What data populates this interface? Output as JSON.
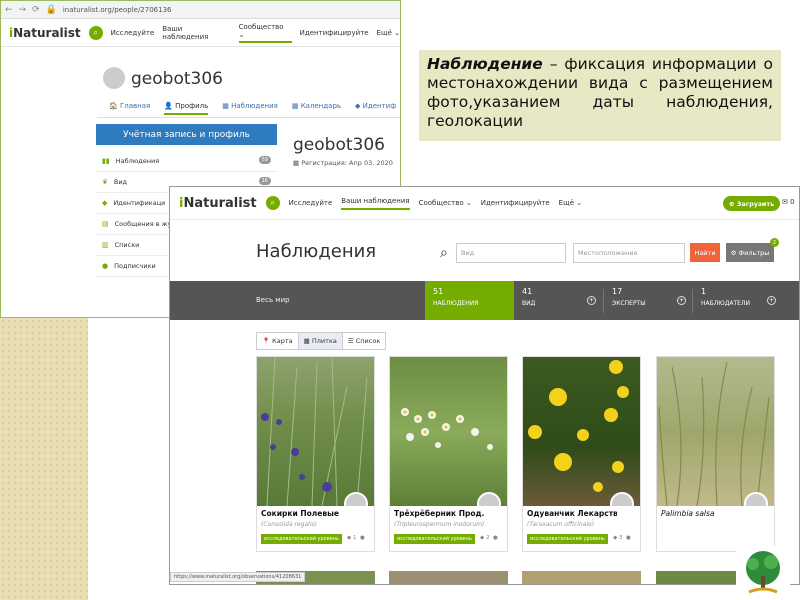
{
  "browser": {
    "url": "inaturalist.org/people/2706136"
  },
  "nav": {
    "logo_i": "i",
    "logo_rest": "Naturalist",
    "explore": "Исследуйте",
    "my_obs": "Ваши наблюдения",
    "community": "Сообщество",
    "identify": "Идентифицируйте",
    "more": "Ещё"
  },
  "profile": {
    "username": "geobot306",
    "tabs": [
      "Главная",
      "Профиль",
      "Наблюдения",
      "Календарь",
      "Идентиф"
    ],
    "account_button": "Учётная запись и профиль",
    "menu": [
      {
        "label": "Наблюдения",
        "badge": "59"
      },
      {
        "label": "Вид",
        "badge": "16"
      },
      {
        "label": "Идентификаци",
        "badge": ""
      },
      {
        "label": "Сообщения в жу",
        "badge": ""
      },
      {
        "label": "Списки",
        "badge": ""
      },
      {
        "label": "Подписчики",
        "badge": ""
      }
    ],
    "registration": "Регистрация: Апр 03, 2020"
  },
  "caption": {
    "term": "Наблюдение",
    "text": " – фиксация информации о местонахождении вида с размещением фото,указанием даты наблюдения, геолокации"
  },
  "obs": {
    "upload": "Загрузить",
    "mail_count": "0",
    "title": "Наблюдения",
    "species_ph": "Вид",
    "location_ph": "Местоположение",
    "find": "Найти",
    "filters": "Фильтры",
    "filter_count": "2",
    "world": "Весь мир",
    "stats": [
      {
        "num": "51",
        "label": "НАБЛЮДЕНИЯ"
      },
      {
        "num": "41",
        "label": "ВИД"
      },
      {
        "num": "17",
        "label": "ЭКСПЕРТЫ"
      },
      {
        "num": "1",
        "label": "НАБЛЮДАТЕЛИ"
      }
    ],
    "views": [
      "Карта",
      "Плитка",
      "Список"
    ],
    "cards": [
      {
        "name": "Сокирки Полевые",
        "latin": "(Consolida regalis)",
        "grade": "исследовательский уровень",
        "count": "1"
      },
      {
        "name": "Трёхрёберник Прод...",
        "latin": "(Tripleurospermum inodorum)",
        "grade": "исследовательский уровень",
        "count": "2"
      },
      {
        "name": "Одуванчик Лекарств...",
        "latin": "(Taraxacum officinale)",
        "grade": "исследовательский уровень",
        "count": "3"
      },
      {
        "name": "Palimbia salsa",
        "latin": "",
        "grade": "",
        "count": ""
      }
    ],
    "status_url": "https://www.inaturalist.org/observations/41208631"
  },
  "colors": {
    "accent": "#74ac00",
    "button_blue": "#2f7bbf",
    "find": "#f0643c",
    "caption_bg": "#e9e8c4"
  }
}
